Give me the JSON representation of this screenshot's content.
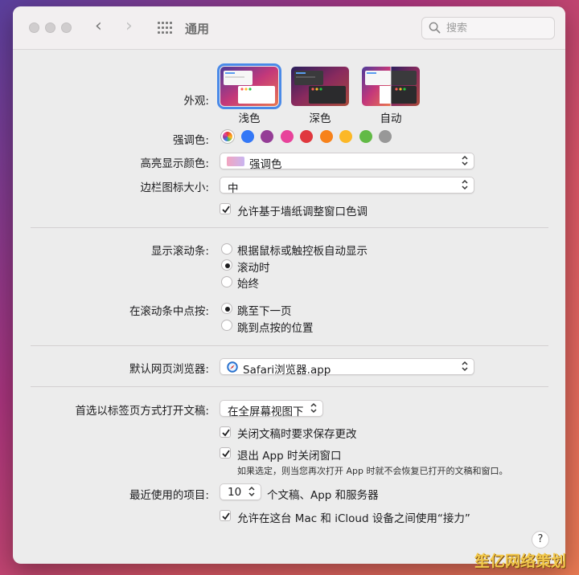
{
  "window": {
    "title": "通用"
  },
  "search": {
    "placeholder": "搜索"
  },
  "appearance": {
    "label": "外观:",
    "options": [
      {
        "name": "浅色",
        "selected": true
      },
      {
        "name": "深色",
        "selected": false
      },
      {
        "name": "自动",
        "selected": false
      }
    ]
  },
  "accent": {
    "label": "强调色:",
    "colors": [
      "multicolor",
      "#3478f6",
      "#953d96",
      "#e8439b",
      "#e0383e",
      "#f7821b",
      "#fcb827",
      "#62ba46",
      "#989898"
    ]
  },
  "highlight": {
    "label": "高亮显示颜色:",
    "value": "强调色"
  },
  "sidebar_icon": {
    "label": "边栏图标大小:",
    "value": "中"
  },
  "wallpaper_tint": {
    "label": "允许基于墙纸调整窗口色调",
    "checked": true
  },
  "scrollbars": {
    "label": "显示滚动条:",
    "options": [
      {
        "label": "根据鼠标或触控板自动显示",
        "selected": false
      },
      {
        "label": "滚动时",
        "selected": true
      },
      {
        "label": "始终",
        "selected": false
      }
    ]
  },
  "scroll_click": {
    "label": "在滚动条中点按:",
    "options": [
      {
        "label": "跳至下一页",
        "selected": true
      },
      {
        "label": "跳到点按的位置",
        "selected": false
      }
    ]
  },
  "browser": {
    "label": "默认网页浏览器:",
    "value": "Safari浏览器.app"
  },
  "tabs": {
    "label": "首选以标签页方式打开文稿:",
    "value": "在全屏幕视图下"
  },
  "ask_save": {
    "label": "关闭文稿时要求保存更改",
    "checked": true
  },
  "close_windows": {
    "label": "退出 App 时关闭窗口",
    "checked": true,
    "note": "如果选定，则当您再次打开 App 时就不会恢复已打开的文稿和窗口。"
  },
  "recent": {
    "label": "最近使用的项目:",
    "value": "10",
    "suffix": "个文稿、App 和服务器"
  },
  "handoff": {
    "label": "允许在这台 Mac 和 iCloud 设备之间使用“接力”",
    "checked": true
  },
  "help": {
    "label": "?"
  },
  "watermark": "笙亿网络策划"
}
